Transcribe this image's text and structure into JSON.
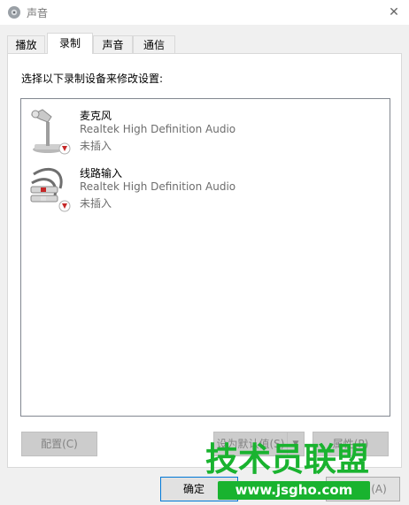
{
  "window": {
    "title": "声音",
    "close_glyph": "✕"
  },
  "tabs": [
    {
      "label": "播放",
      "active": false
    },
    {
      "label": "录制",
      "active": true
    },
    {
      "label": "声音",
      "active": false
    },
    {
      "label": "通信",
      "active": false
    }
  ],
  "panel": {
    "instruction": "选择以下录制设备来修改设置:"
  },
  "devices": [
    {
      "name": "麦克风",
      "driver": "Realtek High Definition Audio",
      "status": "未插入",
      "icon": "microphone-icon"
    },
    {
      "name": "线路输入",
      "driver": "Realtek High Definition Audio",
      "status": "未插入",
      "icon": "line-in-cable-icon"
    }
  ],
  "buttons": {
    "configure": "配置(C)",
    "set_default": "设为默认值(S)",
    "properties": "属性(P)",
    "ok": "确定",
    "apply": "(A)"
  },
  "watermark": {
    "text": "技术员联盟",
    "url": "www.jsgho.com"
  },
  "colors": {
    "watermark_green": "#19b32f",
    "disabled_text": "#838383",
    "secondary_text": "#6d6d6d"
  }
}
